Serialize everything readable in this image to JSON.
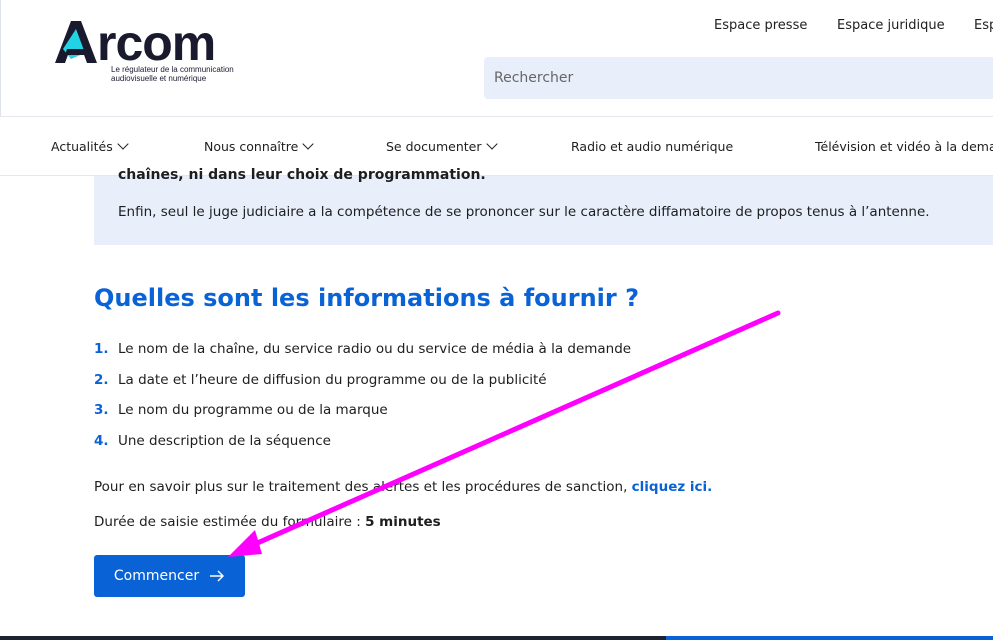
{
  "logo": {
    "word_rest": "rcom",
    "tagline_line1": "Le régulateur de la communication",
    "tagline_line2": "audiovisuelle et numérique"
  },
  "top_links": [
    "Espace presse",
    "Espace juridique",
    "Esp"
  ],
  "search": {
    "placeholder": "Rechercher"
  },
  "nav": [
    {
      "label": "Actualités",
      "dropdown": true
    },
    {
      "label": "Nous connaître",
      "dropdown": true
    },
    {
      "label": "Se documenter",
      "dropdown": true
    },
    {
      "label": "Radio et audio numérique",
      "dropdown": false
    },
    {
      "label": "Télévision et vidéo à la dema",
      "dropdown": false
    }
  ],
  "info_box": {
    "cut_text": "chaînes, ni dans leur choix de programmation.",
    "text": "Enfin, seul le juge judiciaire a la compétence de se prononcer sur le caractère diffamatoire de propos tenus à l’antenne."
  },
  "section": {
    "title": "Quelles sont les informations à fournir ?",
    "steps": [
      {
        "num": "1.",
        "text": "Le nom de la chaîne, du service radio ou du service de média à la demande"
      },
      {
        "num": "2.",
        "text": "La date et l’heure de diffusion du programme ou de la publicité"
      },
      {
        "num": "3.",
        "text": "Le nom du programme ou de la marque"
      },
      {
        "num": "4.",
        "text": "Une description de la séquence"
      }
    ],
    "more_text": "Pour en savoir plus sur le traitement des alertes et les procédures de sanction, ",
    "more_link": "cliquez ici.",
    "duration_text": "Durée de saisie estimée du formulaire : ",
    "duration_value": "5 minutes",
    "button_label": "Commencer"
  },
  "colors": {
    "accent": "#0a63d6",
    "annotation_arrow": "#ff00ff",
    "box_bg": "#e8effb"
  }
}
